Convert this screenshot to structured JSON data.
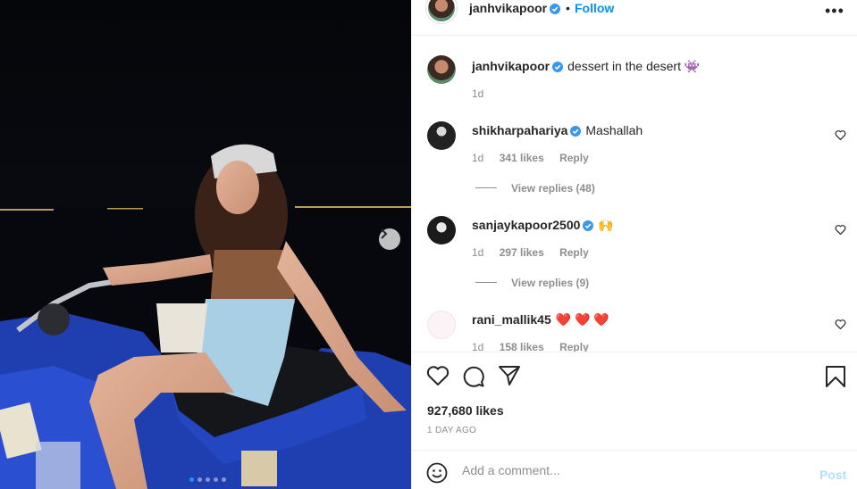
{
  "post": {
    "username": "janhvikapoor",
    "dot": "•",
    "follow_label": "Follow",
    "more_label": "•••",
    "caption_text": "dessert in the desert 👾",
    "caption_age": "1d",
    "likes_count": "927,680 likes",
    "posted_ago": "1 DAY AGO",
    "comment_placeholder": "Add a comment...",
    "post_label": "Post",
    "carousel_dots": 5,
    "active_dot": 0
  },
  "comments": [
    {
      "username": "shikharpahariya",
      "verified": true,
      "text": "Mashallah",
      "age": "1d",
      "likes": "341 likes",
      "reply_label": "Reply",
      "view_replies": "View replies (48)"
    },
    {
      "username": "sanjaykapoor2500",
      "verified": true,
      "text": "🙌",
      "age": "1d",
      "likes": "297 likes",
      "reply_label": "Reply",
      "view_replies": "View replies (9)"
    },
    {
      "username": "rani_mallik45",
      "verified": false,
      "text": "❤️ ❤️ ❤️",
      "age": "1d",
      "likes": "158 likes",
      "reply_label": "Reply"
    }
  ],
  "colors": {
    "link_blue": "#0095f6",
    "verified_blue": "#3897f0",
    "muted_gray": "#8e8e8e",
    "post_disabled": "#b2dffc",
    "atv_blue": "#1f3fb0"
  },
  "icons": {
    "next": "chevron-right-icon",
    "like": "heart-outline-icon",
    "comment": "comment-bubble-icon",
    "share": "paper-plane-icon",
    "save": "bookmark-icon",
    "emoji": "smiley-icon",
    "more": "more-horizontal-icon"
  }
}
